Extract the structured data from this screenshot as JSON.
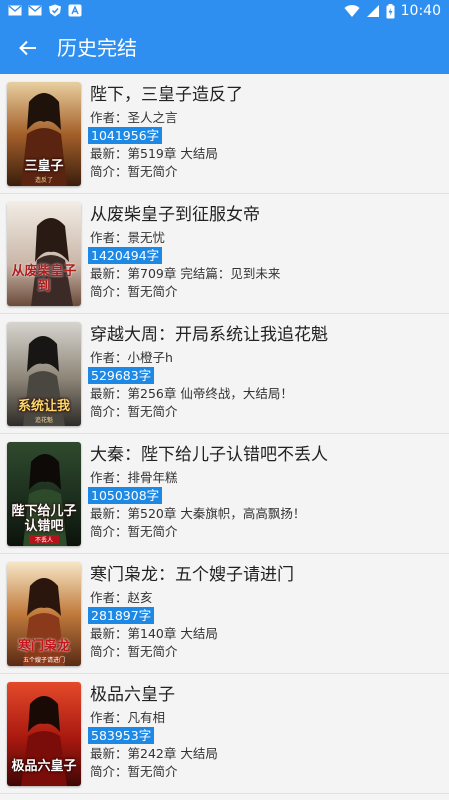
{
  "status_bar": {
    "time": "10:40",
    "left_icons": [
      "mail-icon",
      "mail-icon",
      "shield-icon",
      "text-app-icon"
    ],
    "right_icons": [
      "wifi-icon",
      "signal-icon",
      "battery-icon"
    ]
  },
  "app_bar": {
    "title": "历史完结",
    "color": "#2f8ff0",
    "back_icon": "arrow-left-icon"
  },
  "labels": {
    "author": "作者：",
    "latest": "最新：",
    "intro": "简介："
  },
  "books": [
    {
      "title": "陛下，三皇子造反了",
      "author": "圣人之言",
      "word_count": "1041956字",
      "latest": "第519章 大结局",
      "intro": "暂无简介",
      "cover_text": "三皇子",
      "cover_sub": "造反了"
    },
    {
      "title": "从废柴皇子到征服女帝",
      "author": "景无忧",
      "word_count": "1420494字",
      "latest": "第709章 完结篇：见到未来",
      "intro": "暂无简介",
      "cover_text": "从废柴皇子到",
      "cover_sub": ""
    },
    {
      "title": "穿越大周：开局系统让我追花魁",
      "author": "小橙子h",
      "word_count": "529683字",
      "latest": "第256章 仙帝终战，大结局！",
      "intro": "暂无简介",
      "cover_text": "系统让我",
      "cover_sub": "追花魁"
    },
    {
      "title": "大秦：陛下给儿子认错吧不丢人",
      "author": "排骨年糕",
      "word_count": "1050308字",
      "latest": "第520章 大秦旗帜，高高飘扬！",
      "intro": "暂无简介",
      "cover_text": "陛下给儿子认错吧",
      "cover_sub": "不丢人"
    },
    {
      "title": "寒门枭龙：五个嫂子请进门",
      "author": "赵亥",
      "word_count": "281897字",
      "latest": "第140章 大结局",
      "intro": "暂无简介",
      "cover_text": "寒门枭龙",
      "cover_sub": "五个嫂子请进门"
    },
    {
      "title": "极品六皇子",
      "author": "凡有相",
      "word_count": "583953字",
      "latest": "第242章 大结局",
      "intro": "暂无简介",
      "cover_text": "极品六皇子",
      "cover_sub": ""
    }
  ]
}
